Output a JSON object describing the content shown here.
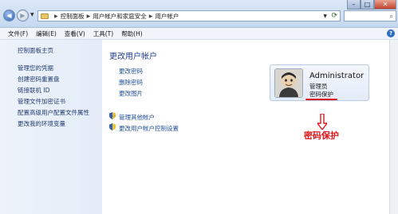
{
  "address": {
    "crumbs": [
      "控制面板",
      "用户帐户和家庭安全",
      "用户帐户"
    ],
    "search_placeholder": ""
  },
  "menu": [
    "文件(F)",
    "编辑(E)",
    "查看(V)",
    "工具(T)",
    "帮助(H)"
  ],
  "sidebar": {
    "home": "控制面板主页",
    "links": [
      "管理您的凭据",
      "创建密码重置盘",
      "链接联机 ID",
      "管理文件加密证书",
      "配置高级用户配置文件属性",
      "更改我的环境变量"
    ]
  },
  "main": {
    "title": "更改用户帐户",
    "tasks": [
      "更改密码",
      "删除密码",
      "更改图片"
    ],
    "shield_tasks": [
      "管理其他帐户",
      "更改用户帐户控制设置"
    ]
  },
  "user": {
    "name": "Administrator",
    "role": "管理员",
    "password_status": "密码保护"
  },
  "annotation": {
    "label": "密码保护",
    "color": "#e2161a"
  },
  "icons": {
    "back": "back-arrow-icon",
    "forward": "forward-arrow-icon",
    "folder": "control-panel-folder-icon",
    "refresh": "refresh-icon",
    "search": "search-icon",
    "shield": "uac-shield-icon",
    "help": "help-icon"
  },
  "colors": {
    "link": "#1d4f9c",
    "title": "#1e3f8c",
    "accent_red": "#e2161a"
  }
}
